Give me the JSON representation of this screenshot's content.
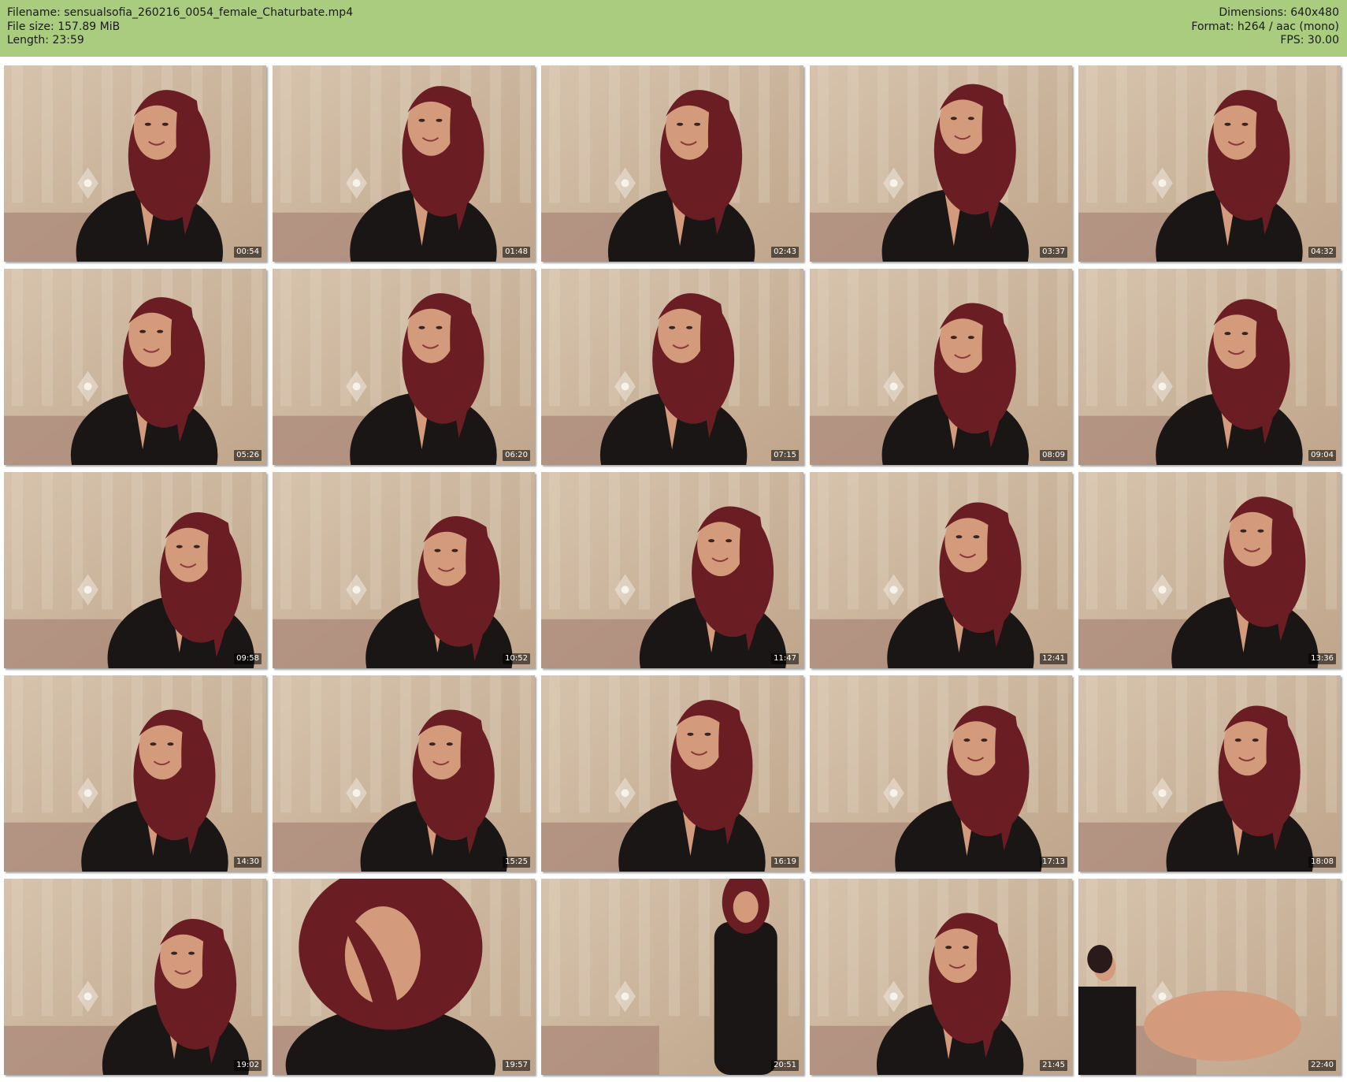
{
  "header": {
    "filename": "Filename: sensualsofia_260216_0054_female_Chaturbate.mp4",
    "filesize": "File size: 157.89 MiB",
    "length": "Length: 23:59",
    "dimensions": "Dimensions: 640x480",
    "format": "Format: h264 / aac (mono)",
    "fps": "FPS: 30.00"
  },
  "colors": {
    "header_bg": "#aacc7f",
    "page_bg": "#ffffff",
    "frame_wall": "#bfa58b",
    "frame_curtain": "#d7c3ad",
    "hair": "#6b1d24",
    "top": "#1b1616",
    "skin": "#d49a7c"
  },
  "thumbnails": [
    {
      "time": "00:54",
      "variant": "portrait",
      "hx": 0.6,
      "hy": 0.3
    },
    {
      "time": "01:48",
      "variant": "portrait",
      "hx": 0.62,
      "hy": 0.28
    },
    {
      "time": "02:43",
      "variant": "portrait",
      "hx": 0.58,
      "hy": 0.3
    },
    {
      "time": "03:37",
      "variant": "portrait",
      "hx": 0.6,
      "hy": 0.27
    },
    {
      "time": "04:32",
      "variant": "portrait",
      "hx": 0.62,
      "hy": 0.3
    },
    {
      "time": "05:26",
      "variant": "portrait",
      "hx": 0.58,
      "hy": 0.32
    },
    {
      "time": "06:20",
      "variant": "portrait",
      "hx": 0.62,
      "hy": 0.3
    },
    {
      "time": "07:15",
      "variant": "portrait",
      "hx": 0.55,
      "hy": 0.3
    },
    {
      "time": "08:09",
      "variant": "portrait",
      "hx": 0.6,
      "hy": 0.35
    },
    {
      "time": "09:04",
      "variant": "portrait",
      "hx": 0.62,
      "hy": 0.33
    },
    {
      "time": "09:58",
      "variant": "portrait",
      "hx": 0.72,
      "hy": 0.38
    },
    {
      "time": "10:52",
      "variant": "portrait",
      "hx": 0.68,
      "hy": 0.4
    },
    {
      "time": "11:47",
      "variant": "portrait",
      "hx": 0.7,
      "hy": 0.35
    },
    {
      "time": "12:41",
      "variant": "portrait",
      "hx": 0.62,
      "hy": 0.33
    },
    {
      "time": "13:36",
      "variant": "portrait",
      "hx": 0.68,
      "hy": 0.3
    },
    {
      "time": "14:30",
      "variant": "portrait",
      "hx": 0.62,
      "hy": 0.35
    },
    {
      "time": "15:25",
      "variant": "portrait",
      "hx": 0.66,
      "hy": 0.35
    },
    {
      "time": "16:19",
      "variant": "portrait",
      "hx": 0.62,
      "hy": 0.3
    },
    {
      "time": "17:13",
      "variant": "portrait",
      "hx": 0.65,
      "hy": 0.33
    },
    {
      "time": "18:08",
      "variant": "portrait",
      "hx": 0.66,
      "hy": 0.33
    },
    {
      "time": "19:02",
      "variant": "portrait",
      "hx": 0.7,
      "hy": 0.38
    },
    {
      "time": "19:57",
      "variant": "closeup",
      "hx": 0.45,
      "hy": 0.35
    },
    {
      "time": "20:51",
      "variant": "standing",
      "hx": 0.78,
      "hy": 0.12
    },
    {
      "time": "21:45",
      "variant": "portrait",
      "hx": 0.58,
      "hy": 0.35
    },
    {
      "time": "22:40",
      "variant": "seated",
      "hx": 0.1,
      "hy": 0.45
    }
  ]
}
